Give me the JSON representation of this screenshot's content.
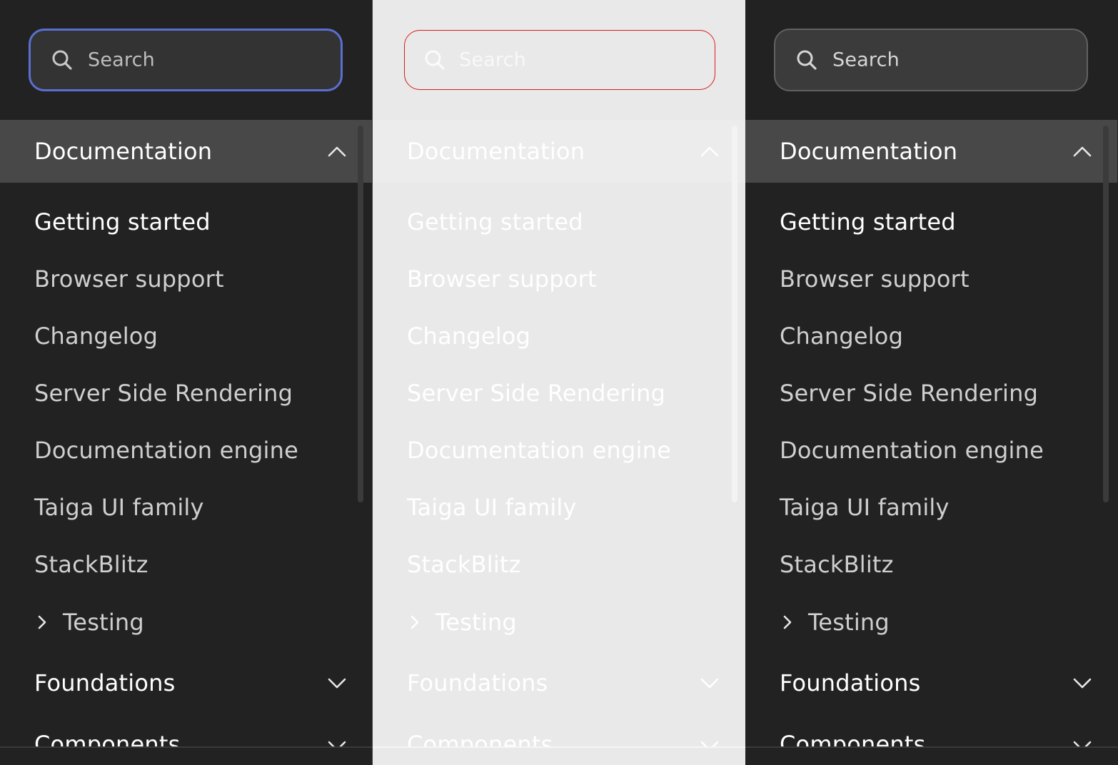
{
  "search": {
    "placeholder": "Search"
  },
  "nav": {
    "section_title": "Documentation",
    "items": [
      {
        "label": "Getting started",
        "active": true
      },
      {
        "label": "Browser support"
      },
      {
        "label": "Changelog"
      },
      {
        "label": "Server Side Rendering"
      },
      {
        "label": "Documentation engine"
      },
      {
        "label": "Taiga UI family"
      },
      {
        "label": "StackBlitz"
      }
    ],
    "testing_label": "Testing",
    "foundations_label": "Foundations",
    "components_label": "Components"
  },
  "colors": {
    "dark_bg": "#222222",
    "light_bg": "#e9e9e9",
    "focus_border": "#5a6fd1",
    "error_border": "#d81b1b",
    "header_dark": "#484848"
  },
  "icons": {
    "search": "search-icon",
    "collapse": "chevron-up-icon",
    "expand": "chevron-down-icon",
    "submenu": "chevron-right-icon"
  }
}
